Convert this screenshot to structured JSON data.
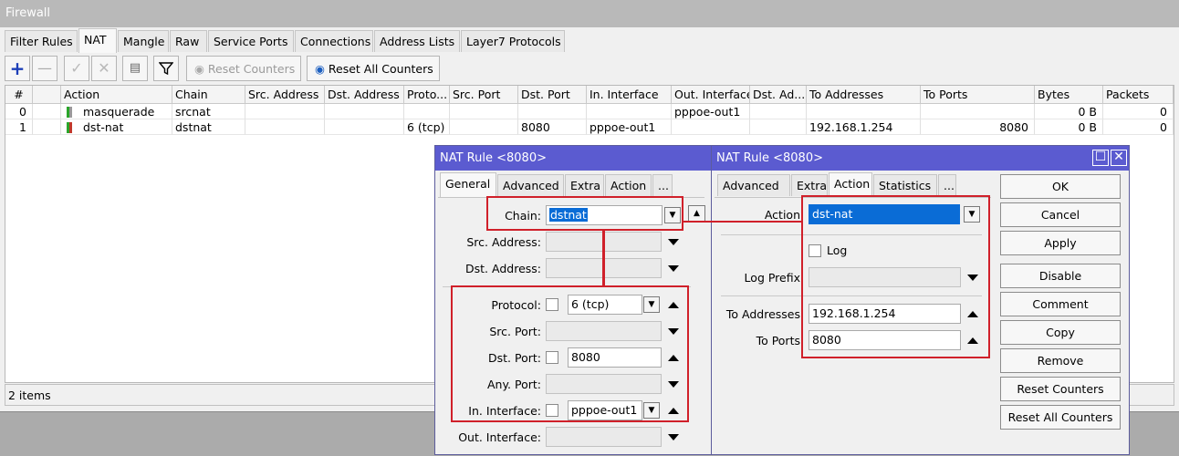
{
  "window": {
    "title": "Firewall"
  },
  "tabs": [
    "Filter Rules",
    "NAT",
    "Mangle",
    "Raw",
    "Service Ports",
    "Connections",
    "Address Lists",
    "Layer7 Protocols"
  ],
  "toolbar": {
    "add_icon": "plus-icon",
    "remove_icon": "minus-icon",
    "enable_icon": "check-icon",
    "disable_icon": "cross-icon",
    "comment_icon": "note-icon",
    "filter_icon": "funnel-icon",
    "reset_counters": "Reset Counters",
    "reset_all_counters": "Reset All Counters"
  },
  "table": {
    "columns": [
      "#",
      "",
      "Action",
      "Chain",
      "Src. Address",
      "Dst. Address",
      "Proto...",
      "Src. Port",
      "Dst. Port",
      "In. Interface",
      "Out. Interface",
      "Dst. Ad...",
      "To Addresses",
      "To Ports",
      "Bytes",
      "Packets"
    ],
    "rows": [
      {
        "num": "0",
        "action": "masquerade",
        "chain": "srcnat",
        "src_address": "",
        "dst_address": "",
        "protocol": "",
        "src_port": "",
        "dst_port": "",
        "in_interface": "",
        "out_interface": "pppoe-out1",
        "dst_ad": "",
        "to_addresses": "",
        "to_ports": "",
        "bytes": "0 B",
        "packets": "0"
      },
      {
        "num": "1",
        "action": "dst-nat",
        "chain": "dstnat",
        "src_address": "",
        "dst_address": "",
        "protocol": "6 (tcp)",
        "src_port": "",
        "dst_port": "8080",
        "in_interface": "pppoe-out1",
        "out_interface": "",
        "dst_ad": "",
        "to_addresses": "192.168.1.254",
        "to_ports": "8080",
        "bytes": "0 B",
        "packets": "0"
      }
    ]
  },
  "status": {
    "items": "2 items"
  },
  "dialog_left": {
    "title": "NAT Rule <8080>",
    "tabs": [
      "General",
      "Advanced",
      "Extra",
      "Action",
      "..."
    ],
    "fields": {
      "chain": {
        "label": "Chain:",
        "value": "dstnat"
      },
      "src_address": {
        "label": "Src. Address:",
        "value": ""
      },
      "dst_address": {
        "label": "Dst. Address:",
        "value": ""
      },
      "protocol": {
        "label": "Protocol:",
        "value": "6 (tcp)"
      },
      "src_port": {
        "label": "Src. Port:",
        "value": ""
      },
      "dst_port": {
        "label": "Dst. Port:",
        "value": "8080"
      },
      "any_port": {
        "label": "Any. Port:",
        "value": ""
      },
      "in_interface": {
        "label": "In. Interface:",
        "value": "pppoe-out1"
      },
      "out_interface": {
        "label": "Out. Interface:",
        "value": ""
      }
    }
  },
  "dialog_right": {
    "title": "NAT Rule <8080>",
    "tabs": [
      "Advanced",
      "Extra",
      "Action",
      "Statistics",
      "..."
    ],
    "fields": {
      "action": {
        "label": "Action",
        "value": "dst-nat"
      },
      "log": {
        "label": "Log"
      },
      "log_prefix": {
        "label": "Log Prefix",
        "value": ""
      },
      "to_addresses": {
        "label": "To Addresses",
        "value": "192.168.1.254"
      },
      "to_ports": {
        "label": "To Ports",
        "value": "8080"
      }
    },
    "buttons": [
      "OK",
      "Cancel",
      "Apply",
      "Disable",
      "Comment",
      "Copy",
      "Remove",
      "Reset Counters",
      "Reset All Counters"
    ]
  },
  "colors": {
    "highlight_red": "#d0202a",
    "dialog_title_bg": "#5b5bd0",
    "selection_blue": "#0a6cd6"
  }
}
